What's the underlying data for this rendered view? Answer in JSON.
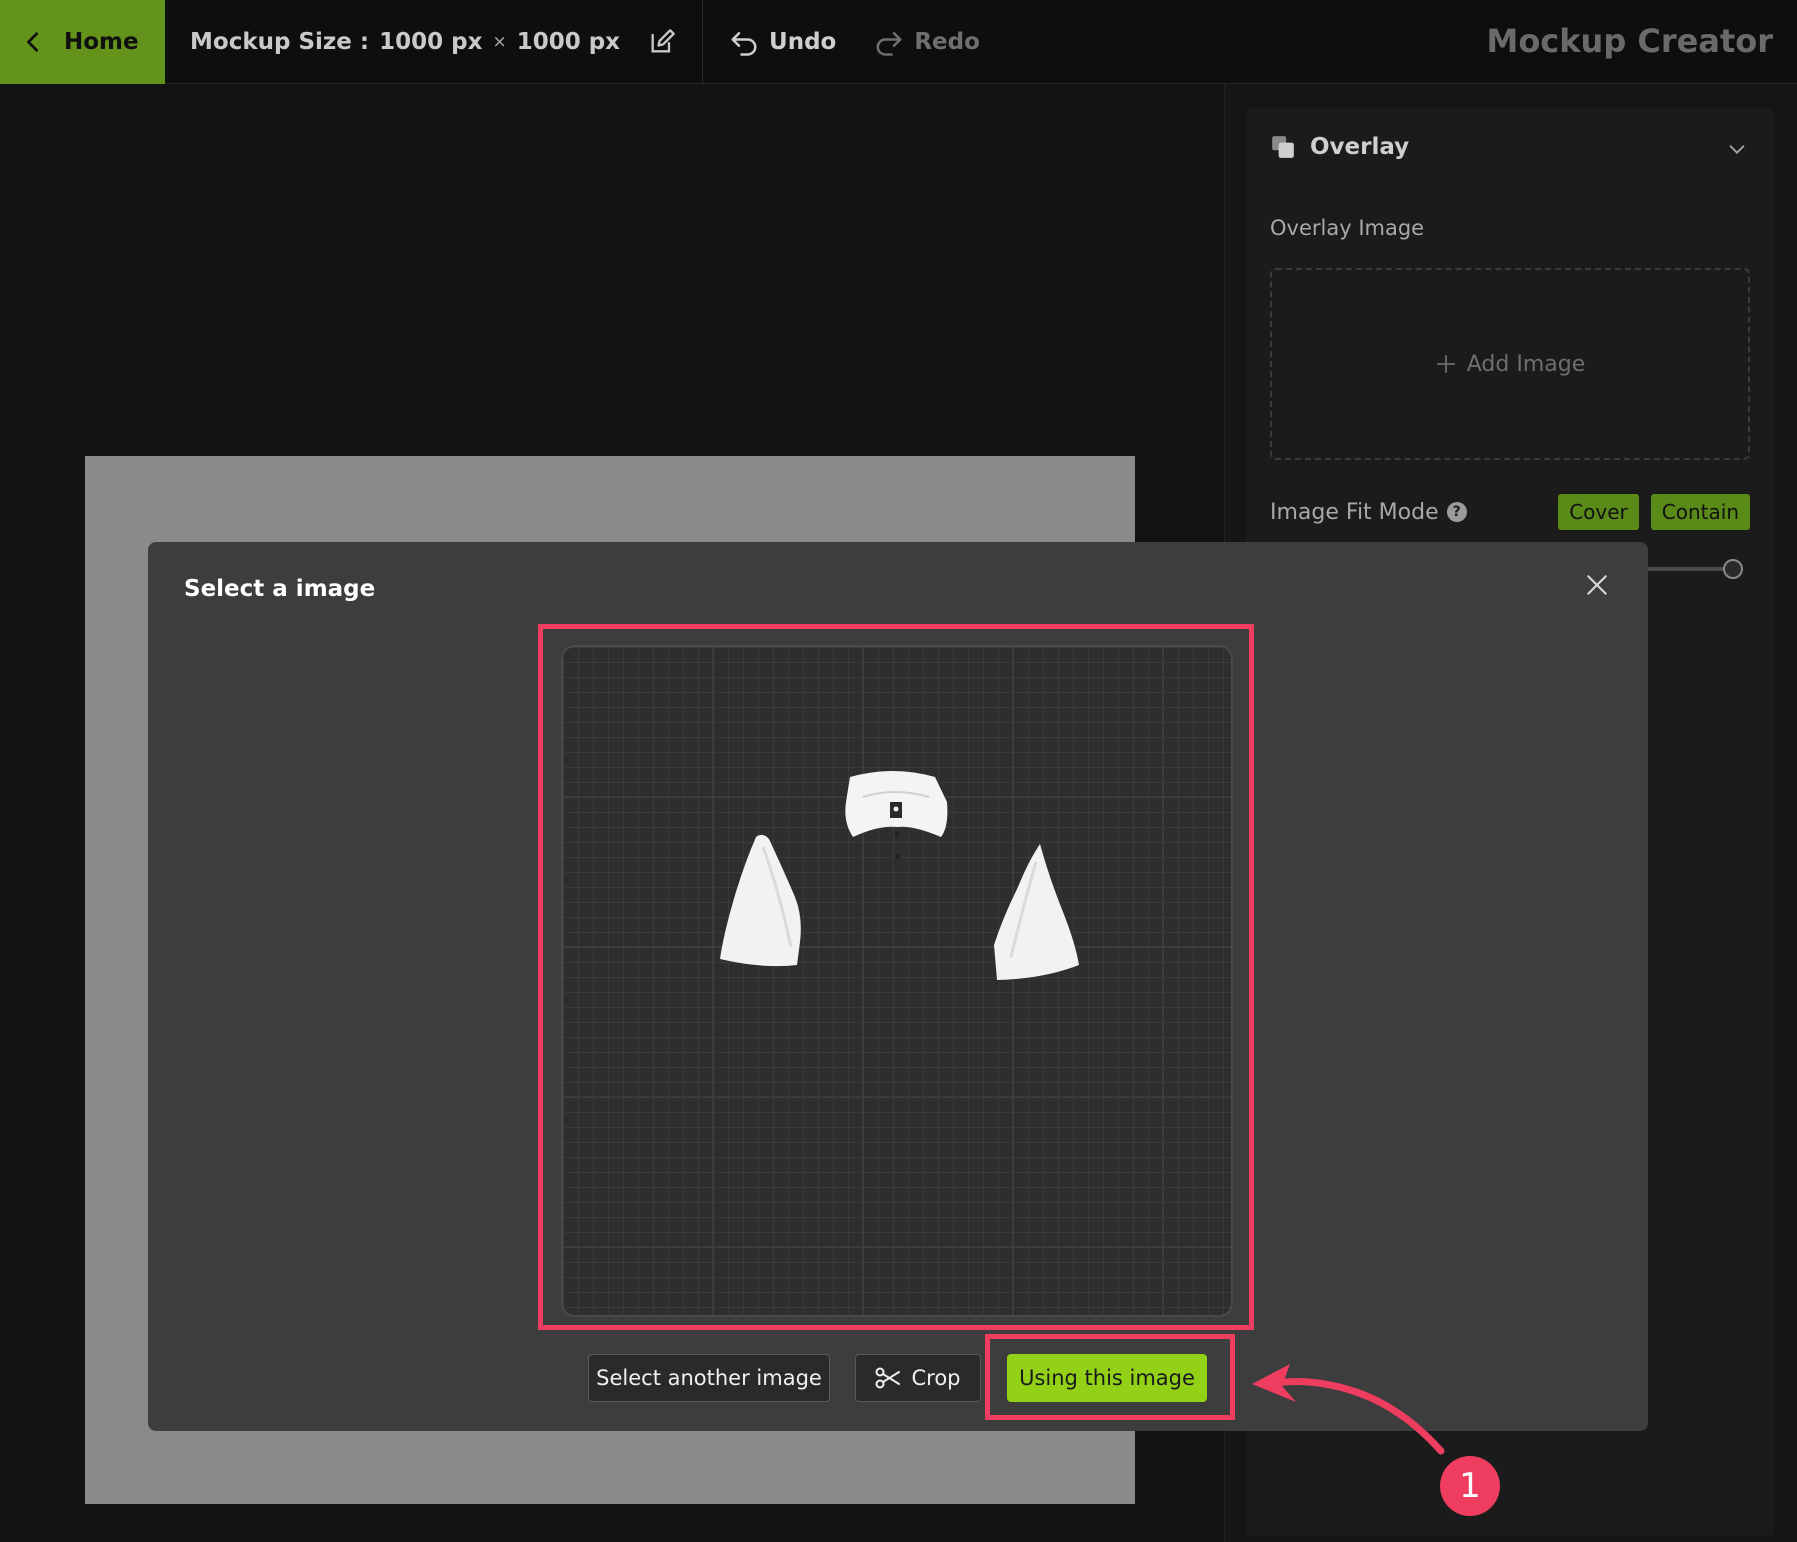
{
  "topbar": {
    "home_label": "Home",
    "mockup_size_label": "Mockup Size :",
    "width_value": "1000 px",
    "times_symbol": "×",
    "height_value": "1000 px",
    "undo_label": "Undo",
    "redo_label": "Redo",
    "app_title": "Mockup Creator"
  },
  "panel": {
    "title": "Overlay",
    "overlay_image_label": "Overlay Image",
    "add_image_label": "Add Image",
    "fit_mode_label": "Image Fit Mode",
    "fit_help_symbol": "?",
    "fit_modes": [
      "Cover",
      "Contain"
    ]
  },
  "modal": {
    "title": "Select a image",
    "select_another_label": "Select another image",
    "crop_label": "Crop",
    "use_label": "Using this image"
  },
  "annotation": {
    "step_number": "1",
    "color": "#ee3d5e"
  },
  "colors": {
    "accent_green": "#93d117",
    "home_green": "#64931c",
    "highlight_red": "#ee3d5e"
  },
  "icons": [
    "chevron-left-icon",
    "edit-icon",
    "undo-icon",
    "redo-icon",
    "layers-icon",
    "chevron-down-icon",
    "plus-icon",
    "help-icon",
    "close-icon",
    "scissors-icon"
  ]
}
